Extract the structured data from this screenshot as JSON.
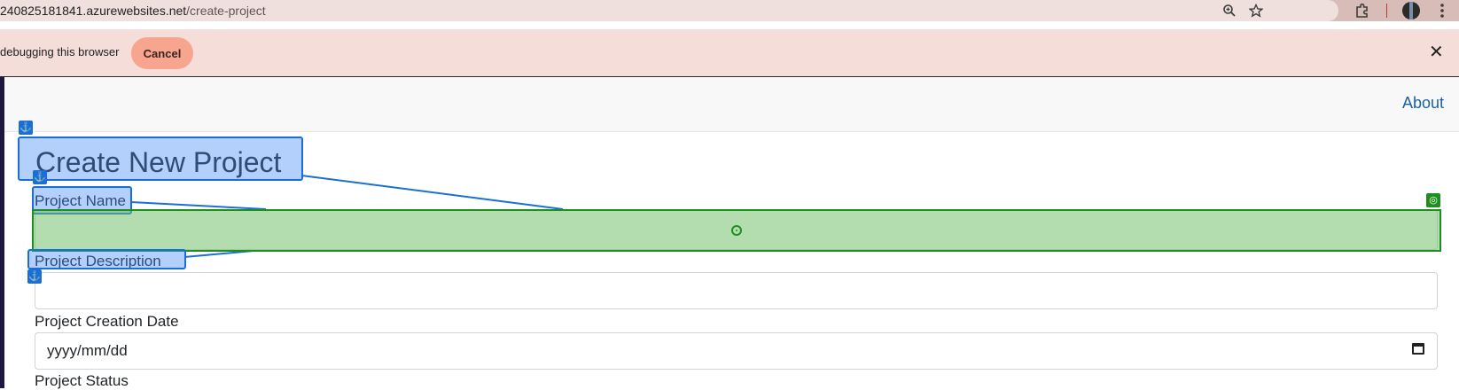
{
  "browser": {
    "url_host": "240825181841.azurewebsites.net",
    "url_path": "/create-project",
    "icons": [
      "zoom-icon",
      "bookmark-star-icon",
      "extensions-icon",
      "profile-avatar",
      "menu-kebab-icon"
    ]
  },
  "infobar": {
    "message": "debugging this browser",
    "cancel_label": "Cancel",
    "close_label": "✕"
  },
  "navbar": {
    "about_label": "About"
  },
  "form": {
    "title": "Create New Project",
    "project_name_label": "Project Name",
    "project_name_value": "",
    "project_description_label": "Project Description",
    "project_description_value": "",
    "creation_date_label": "Project Creation Date",
    "creation_date_placeholder": "yyyy/mm/dd",
    "status_label": "Project Status"
  },
  "overlay": {
    "anchor_glyph": "⚓",
    "target_glyph": "◎",
    "colors": {
      "anchor": "#1a6fd6",
      "target": "#1e8f1e"
    }
  }
}
